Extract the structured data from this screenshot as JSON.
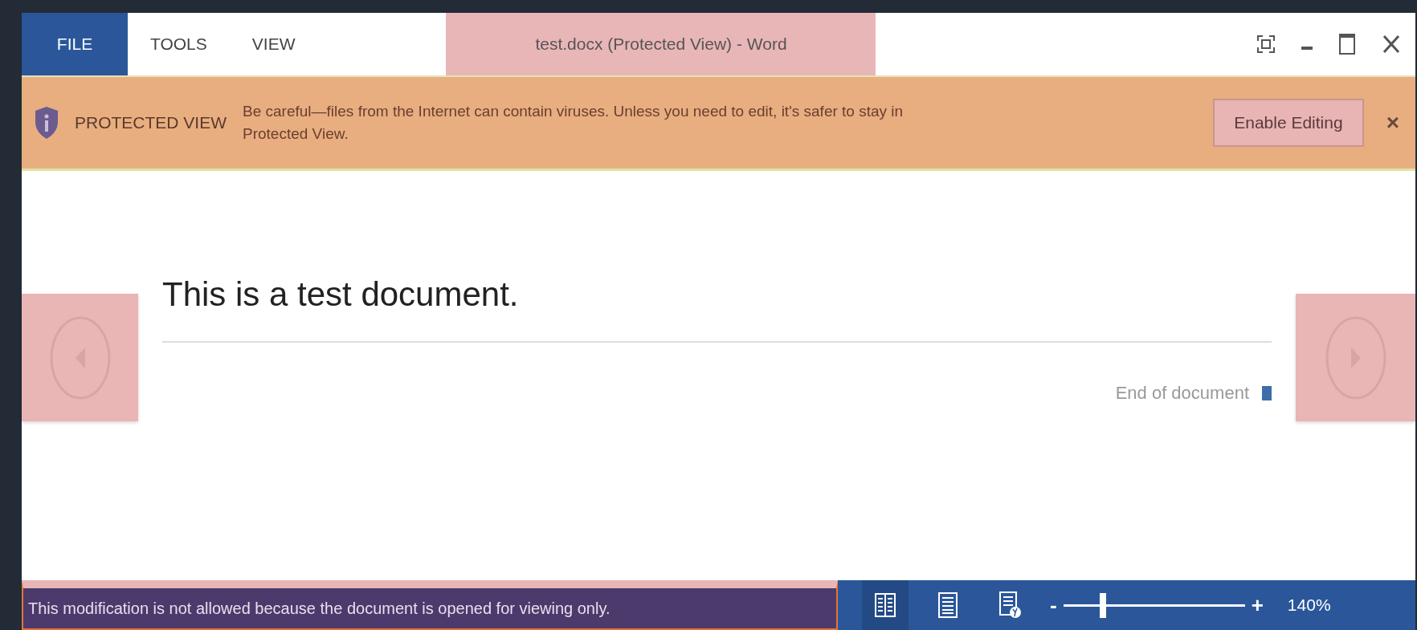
{
  "window": {
    "title": "test.docx (Protected View) - Word"
  },
  "menu_tabs": [
    {
      "label": "FILE",
      "selected": true
    },
    {
      "label": "TOOLS",
      "selected": false
    },
    {
      "label": "VIEW",
      "selected": false
    }
  ],
  "message_bar": {
    "label": "PROTECTED VIEW",
    "message": "Be careful—files from the Internet can contain viruses. Unless you need to edit, it's safer to stay in Protected View.",
    "button": "Enable Editing",
    "close": "×"
  },
  "document": {
    "heading": "This is a test document.",
    "end_label": "End of document"
  },
  "status_bar": {
    "message": "This modification is not allowed because the document is opened for viewing only.",
    "views": [
      {
        "kind": "read",
        "selected": true
      },
      {
        "kind": "print",
        "selected": false
      },
      {
        "kind": "web",
        "selected": false
      }
    ],
    "zoom": {
      "minus": "-",
      "plus": "+",
      "level": 0.22,
      "reading": "140%"
    }
  }
}
